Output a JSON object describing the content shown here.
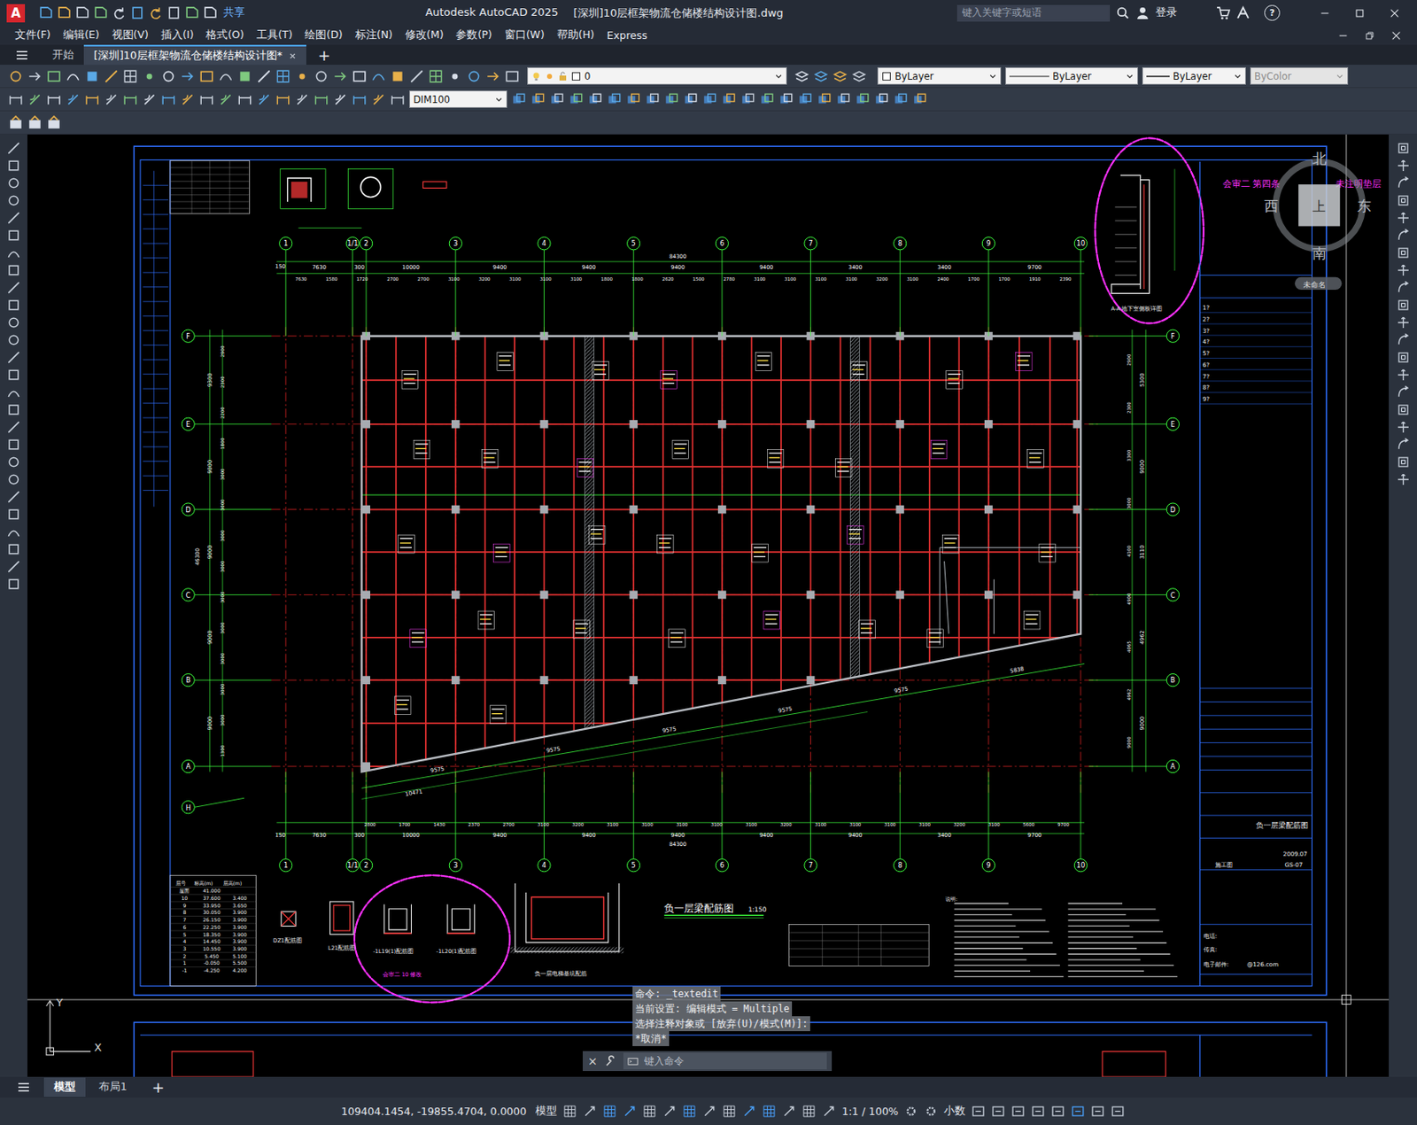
{
  "titleBar": {
    "logo": "A",
    "share": "共享",
    "app": "Autodesk AutoCAD 2025",
    "document": "[深圳]10层框架物流仓储楼结构设计图.dwg",
    "searchPlaceholder": "键入关键字或短语",
    "login": "登录",
    "help": "?"
  },
  "menus": [
    "文件(F)",
    "编辑(E)",
    "视图(V)",
    "插入(I)",
    "格式(O)",
    "工具(T)",
    "绘图(D)",
    "标注(N)",
    "修改(M)",
    "参数(P)",
    "窗口(W)",
    "帮助(H)",
    "Express"
  ],
  "fileTabs": [
    {
      "label": "开始",
      "selected": false
    },
    {
      "label": "[深圳]10层框架物流仓储楼结构设计图*",
      "selected": true
    }
  ],
  "newTab": "+",
  "properties": {
    "layer": "0",
    "color": "ByLayer",
    "linetype": "ByLayer",
    "lineweight": "ByLayer",
    "plotStyle": "ByColor",
    "plotStyleDisabled": true,
    "dimStyle": "DIM100"
  },
  "drawing": {
    "columns": [
      "1",
      "1/1",
      "2",
      "3",
      "4",
      "5",
      "6",
      "7",
      "8",
      "9",
      "10"
    ],
    "rows": [
      "F",
      "E",
      "D",
      "C",
      "B",
      "A"
    ],
    "extraRow": "H",
    "overall": "84300",
    "overallLeft": "46300",
    "edgeDim": "150",
    "topSpans": [
      "7630",
      "300",
      "10000",
      "9400",
      "9400",
      "9400",
      "9400",
      "3400",
      "3400",
      "9700"
    ],
    "topDetail": [
      "7630",
      "1580",
      "1720",
      "2700",
      "2700",
      "3100",
      "3200",
      "3100",
      "3100",
      "3100",
      "1800",
      "1800",
      "2620",
      "1500",
      "2780",
      "3100",
      "3100",
      "3100",
      "3100",
      "3200",
      "3100",
      "2400",
      "1700",
      "1700",
      "1910",
      "2390"
    ],
    "bottomSpans": [
      "7630",
      "300",
      "10000",
      "9400",
      "9400",
      "9400",
      "9400",
      "9400",
      "3400",
      "9700"
    ],
    "bottomDetail": [
      "2800",
      "1700",
      "1430",
      "2370",
      "2700",
      "3100",
      "3200",
      "3100",
      "3100",
      "3100",
      "3100",
      "3100",
      "3200",
      "3100",
      "3100",
      "3100",
      "3100",
      "3200",
      "3100",
      "5600",
      "9700"
    ],
    "leftSpans": [
      "9300",
      "9000",
      "9000",
      "9000",
      "9000"
    ],
    "leftDetail": [
      "2900",
      "2300",
      "2200",
      "1800",
      "3000",
      "3000",
      "3000",
      "3000",
      "3000",
      "3000",
      "3000",
      "3000",
      "3000",
      "1300"
    ],
    "rightSpans": [
      "5300",
      "9000",
      "3110",
      "4962",
      "9000"
    ],
    "rightDetail": [
      "2900",
      "2300",
      "3300",
      "3000",
      "4100",
      "4900",
      "4065",
      "4962",
      "9000"
    ],
    "diagonalDims": [
      "9575",
      "9575",
      "9575",
      "9575",
      "9575",
      "5838"
    ],
    "diagonalOverall": "10471",
    "planTitle": "负一层梁配筋图",
    "planScale": "1:150",
    "sectionTitle": "A-A 地下室侧板详图",
    "details": [
      "DZ1配筋图",
      "L21配筋图",
      "-1L19(1)配筋图",
      "-1L20(1)配筋图",
      "负一层电梯基坑配筋"
    ],
    "revisionNotes": {
      "top": "会审二  第四条",
      "topEnd": "未注明垫层",
      "bottom": "会审二 10  修改"
    },
    "notesTitle": "说明:",
    "levelTable": {
      "header": [
        "层号",
        "标高(m)",
        "层高(m)"
      ],
      "rows": [
        [
          "屋面",
          "41.000",
          ""
        ],
        [
          "10",
          "37.600",
          "3.400"
        ],
        [
          "9",
          "33.950",
          "3.650"
        ],
        [
          "8",
          "30.050",
          "3.900"
        ],
        [
          "7",
          "26.150",
          "3.900"
        ],
        [
          "6",
          "22.250",
          "3.900"
        ],
        [
          "5",
          "18.350",
          "3.900"
        ],
        [
          "4",
          "14.450",
          "3.900"
        ],
        [
          "3",
          "10.550",
          "3.900"
        ],
        [
          "2",
          "5.450",
          "5.100"
        ],
        [
          "1",
          "-0.050",
          "5.500"
        ],
        [
          "-1",
          "-4.250",
          "4.200"
        ]
      ]
    },
    "titleBlock": {
      "revisions": [
        "1?",
        "2?",
        "3?",
        "4?",
        "5?",
        "6?",
        "7?",
        "8?",
        "9?"
      ],
      "drawingName": "负一层梁配筋图",
      "number": "GS-07",
      "date": "2009.07",
      "stage": "施工图",
      "phone": "电话:",
      "fax": "传真:",
      "email": "电子邮件:",
      "emailValue": "@126.com"
    }
  },
  "viewCube": {
    "north": "北",
    "south": "南",
    "west": "西",
    "east": "东",
    "face": "上",
    "ucs": "未命名"
  },
  "ucsIcon": {
    "x": "X",
    "y": "Y"
  },
  "commandHistory": [
    "命令:  _textedit",
    "当前设置: 编辑模式 = Multiple",
    "选择注释对象或 [放弃(U)/模式(M)]:",
    "*取消*"
  ],
  "commandInput": {
    "placeholder": "键入命令",
    "close": "×"
  },
  "layoutTabs": [
    {
      "label": "模型",
      "selected": true
    },
    {
      "label": "布局1",
      "selected": false
    }
  ],
  "addLayout": "+",
  "statusBar": {
    "coords": "109404.1454, -19855.4704, 0.0000",
    "space": "模型",
    "scale": "1:1 / 100%",
    "units": "小数"
  }
}
